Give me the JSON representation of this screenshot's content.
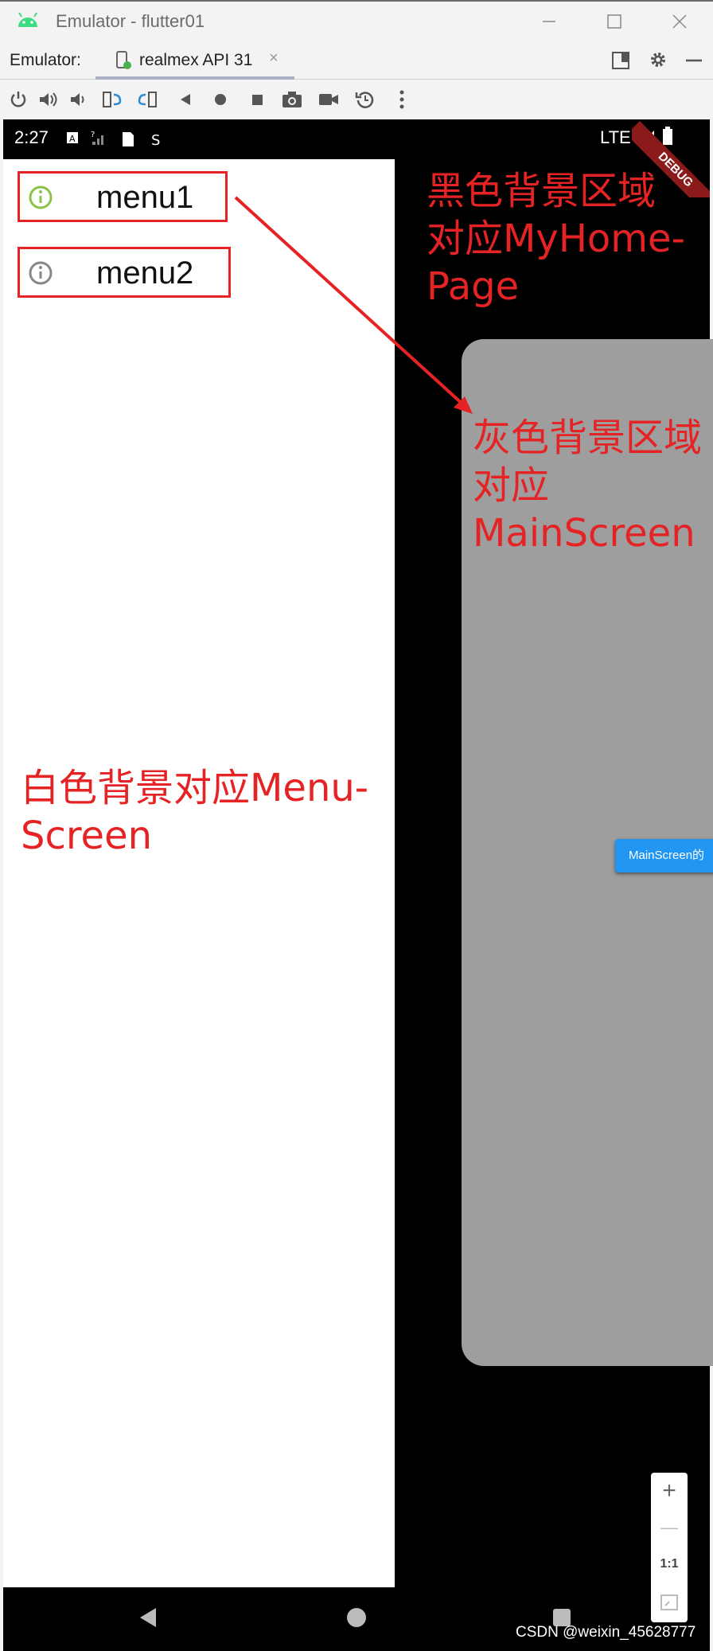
{
  "window": {
    "title": "Emulator - flutter01"
  },
  "tabs": {
    "label": "Emulator:",
    "device_tab": "realmex API 31",
    "close": "×"
  },
  "statusbar": {
    "time": "2:27",
    "network": "LTE"
  },
  "debug_banner": "DEBUG",
  "menu": {
    "items": [
      {
        "label": "menu1"
      },
      {
        "label": "menu2"
      }
    ]
  },
  "main_button": {
    "label": "MainScreen的"
  },
  "annotations": {
    "black_area": [
      "黑色背景区域",
      "对应MyHome-",
      "Page"
    ],
    "grey_area": [
      "灰色背景区域",
      "对应",
      "MainScreen"
    ],
    "white_area": [
      "白色背景对应Menu-",
      "Screen"
    ]
  },
  "zoom": {
    "plus": "+",
    "minus": "—",
    "ratio": "1:1"
  },
  "watermark": "CSDN @weixin_45628777",
  "colors": {
    "annotation": "#e52324",
    "grey_screen": "#9e9e9e",
    "button": "#2196f3",
    "android_green": "#3ddc84"
  }
}
